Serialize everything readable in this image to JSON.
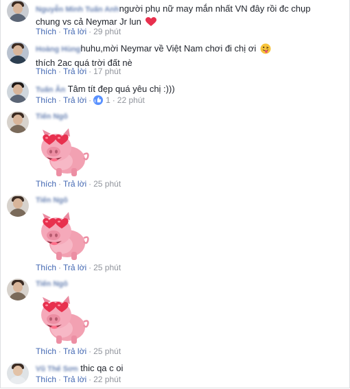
{
  "comments": [
    {
      "author": "Nguyễn Minh Tuấn Anh",
      "text": "người phụ nữ may mắn nhất VN đây rồi đc chụp",
      "text_line2": "chung vs cả Neymar Jr lun",
      "emoji": "red-heart-icon",
      "actions": {
        "like": "Thích",
        "reply": "Trả lời",
        "time": "29 phút"
      }
    },
    {
      "author": "Hoàng Hùng",
      "text": "huhu,mời Neymar về Việt Nam chơi đi chị ơi",
      "text_line2": "thích 2ac quá trời đất nè",
      "emoji": "tongue-out-emoji-icon",
      "actions": {
        "like": "Thích",
        "reply": "Trả lời",
        "time": "17 phút"
      }
    },
    {
      "author": "Tuấn Ân",
      "text": "Tâm tít đẹp quá yêu chị :)))",
      "actions": {
        "like": "Thích",
        "reply": "Trả lời",
        "reactions": "1",
        "time": "22 phút"
      }
    },
    {
      "author": "Tiến Ngô",
      "sticker": "pig-heart-eyes-sticker",
      "actions": {
        "like": "Thích",
        "reply": "Trả lời",
        "time": "25 phút"
      }
    },
    {
      "author": "Tiến Ngô",
      "sticker": "pig-heart-eyes-sticker",
      "actions": {
        "like": "Thích",
        "reply": "Trả lời",
        "time": "25 phút"
      }
    },
    {
      "author": "Tiến Ngô",
      "sticker": "pig-heart-eyes-sticker",
      "actions": {
        "like": "Thích",
        "reply": "Trả lời",
        "time": "25 phút"
      }
    },
    {
      "author": "Vũ Thế Sơn",
      "text": "thic qa c oi",
      "actions": {
        "like": "Thích",
        "reply": "Trả lời",
        "time": "22 phút"
      }
    }
  ],
  "colors": {
    "link": "#4267b2",
    "author": "#365899",
    "meta": "#90949c",
    "text": "#1d2129",
    "like_badge": "#5890ff",
    "sticker_pink": "#f4a3b4",
    "sticker_heart": "#e8304e"
  }
}
